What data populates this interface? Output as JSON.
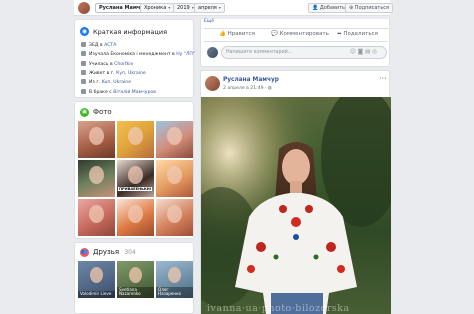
{
  "topbar": {
    "profile_name": "Руслана Мамчур",
    "category": "Хроника",
    "year": "2019",
    "month": "апреля",
    "add_label": "Добавить",
    "follow_label": "Подписаться"
  },
  "intro": {
    "title": "Краткая информация",
    "rows": [
      {
        "prefix": "ЗЕД в ",
        "link": "АСТА",
        "suffix": ""
      },
      {
        "prefix": "Изучала Економіка і менеджмент в ",
        "link": "Ну \"ЛП\"",
        "suffix": ""
      },
      {
        "prefix": "Училась в ",
        "link": "Chortkiv",
        "suffix": ""
      },
      {
        "prefix": "Живет в г. ",
        "link": "Куп, Ukraine",
        "suffix": ""
      },
      {
        "prefix": "Из г. ",
        "link": "Kuп, Ukraine",
        "suffix": ""
      },
      {
        "prefix": "В браке с ",
        "link": "Віталій Мамчуров",
        "suffix": ""
      }
    ]
  },
  "photos": {
    "title": "Фото",
    "tiles": [
      {
        "bg": "linear-gradient(160deg,#d9a38c,#a35c44 60%,#6d3a2b)"
      },
      {
        "bg": "linear-gradient(140deg,#f2c14e,#e0a33a 50%,#b66b3f)"
      },
      {
        "bg": "linear-gradient(150deg,#9fc3e0,#d38e7a 55%,#8b4a3b)"
      },
      {
        "bg": "linear-gradient(160deg,#2f3a2e,#6b7f5c 50%,#c89378)"
      },
      {
        "bg": "linear-gradient(150deg,#e8d8cf,#3a2b26 60%,#bfa79b)"
      },
      {
        "bg": "linear-gradient(150deg,#ffd9a8,#e59b61 55%,#b0573b)"
      },
      {
        "bg": "linear-gradient(150deg,#eaa7a3,#c76b5e 55%,#8e4638)"
      },
      {
        "bg": "linear-gradient(150deg,#fbe4d6,#e07c45 55%,#9a4a2d)"
      },
      {
        "bg": "linear-gradient(150deg,#f5ddcf,#d4835d 55%,#a04d36)"
      }
    ],
    "overlay_text": "ПРИВАЕЕНЬКИ!"
  },
  "friends": {
    "title": "Друзья",
    "count": "304",
    "items": [
      {
        "name": "Volodimir Lieve",
        "bg": "linear-gradient(160deg,#6d87a8,#3c4f6b)"
      },
      {
        "name": "Svetlana Nazarenko",
        "bg": "linear-gradient(160deg,#7e9a68,#3f5433)"
      },
      {
        "name": "Олег Назаренко",
        "bg": "linear-gradient(160deg,#9bb8cf,#4b6d85)"
      }
    ]
  },
  "composer": {
    "like": "Нравится",
    "comment": "Комментировать",
    "share": "Поделиться",
    "comment_placeholder": "Напишите комментарий...",
    "more_link": "Ещё"
  },
  "post": {
    "author": "Руслана Мамчур",
    "date": "2 апреля в 21:49 · ",
    "watermark": "ivanna·ua·photo·bilozorska",
    "privacy": "globe-icon"
  }
}
